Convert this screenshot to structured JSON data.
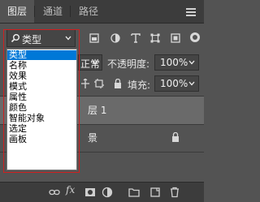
{
  "tabs": [
    "图层",
    "通道",
    "路径"
  ],
  "filter": {
    "label": "类型"
  },
  "blend_mode": {
    "value": "正常"
  },
  "opacity": {
    "label": "不透明度:",
    "value": "100%"
  },
  "fill": {
    "label": "填充:",
    "value": "100%"
  },
  "layers": [
    {
      "name": "层 1"
    },
    {
      "name": "景"
    }
  ],
  "dropdown": {
    "options": [
      "类型",
      "名称",
      "效果",
      "模式",
      "属性",
      "颜色",
      "智能对象",
      "选定",
      "画板"
    ],
    "selected_index": 0
  },
  "bottom_bar": {
    "fx_label": "fx"
  },
  "colors": {
    "panel_bg": "#535353",
    "selection": "#0078d7",
    "annotation": "#d02020"
  }
}
